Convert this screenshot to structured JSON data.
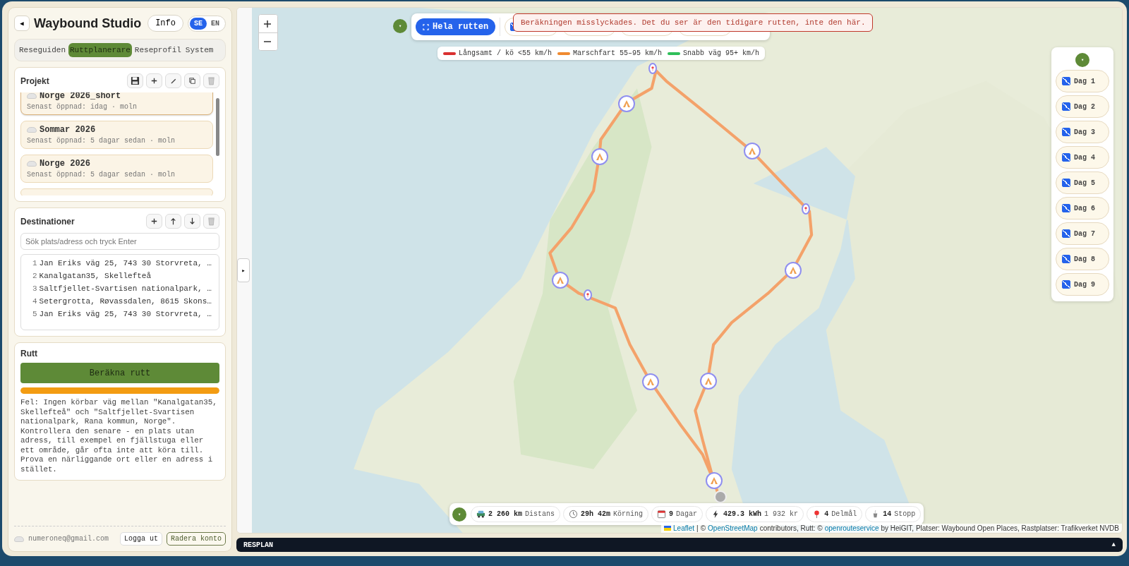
{
  "sidebar": {
    "collapse_button": "◀",
    "title": "Waybound Studio",
    "info_button": "Info",
    "languages": [
      {
        "label": "SE",
        "selected": true
      },
      {
        "label": "EN",
        "selected": false
      }
    ],
    "tabs": [
      {
        "label": "Reseguiden",
        "selected": false
      },
      {
        "label": "Ruttplanerare",
        "selected": true
      },
      {
        "label": "Reseprofil",
        "selected": false
      },
      {
        "label": "System",
        "selected": false
      }
    ],
    "projects": {
      "title": "Projekt",
      "items": [
        {
          "name": "Norge 2026_short",
          "subtitle": "Senast öppnad: idag · moln",
          "selected": true
        },
        {
          "name": "Sommar 2026",
          "subtitle": "Senast öppnad: 5 dagar sedan · moln",
          "selected": false
        },
        {
          "name": "Norge 2026",
          "subtitle": "Senast öppnad: 5 dagar sedan · moln",
          "selected": false
        }
      ]
    },
    "destinations": {
      "title": "Destinationer",
      "search": {
        "placeholder": "Sök plats/adress och tryck Enter"
      },
      "items": [
        {
          "number": "1",
          "text": "Jan Eriks väg 25, 743 30 Storvreta, …"
        },
        {
          "number": "2",
          "text": "Kanalgatan35, Skellefteå"
        },
        {
          "number": "3",
          "text": "Saltfjellet-Svartisen nationalpark, …"
        },
        {
          "number": "4",
          "text": "Setergrotta, Røvassdalen, 8615 Skons…"
        },
        {
          "number": "5",
          "text": "Jan Eriks väg 25, 743 30 Storvreta, …"
        }
      ]
    },
    "route": {
      "title": "Rutt",
      "button": "Beräkna rutt",
      "progress": {
        "level": 1
      },
      "error": "Fel: Ingen körbar väg mellan \"Kanalgatan35, Skellefteå\" och \"Saltfjellet-Svartisen nationalpark, Rana kommun, Norge\". Kontrollera den senare - en plats utan adress, till exempel en fjällstuga eller ett område, går ofta inte att köra till. Prova en närliggande ort eller en adress i stället."
    },
    "account": {
      "email": "numeroneq@gmail.com",
      "buttons": [
        "Logga ut",
        "Radera konto"
      ]
    }
  },
  "map": {
    "sidebar_toggle": "▸",
    "toolbar_toggle": "▾",
    "fit_button": "Hela rutten",
    "layer_checked": true,
    "error_toast": "Beräkningen misslyckades. Det du ser är den tidigare rutten, inte den här.",
    "legend": [
      {
        "label": "Långsamt / kö <55 km/h",
        "color": "#d93030"
      },
      {
        "label": "Marschfart 55–95 km/h",
        "color": "#f08a30"
      },
      {
        "label": "Snabb väg 95+ km/h",
        "color": "#2fbf5a"
      }
    ],
    "days_toggle": "▾",
    "days": [
      {
        "label": "Dag 1",
        "checked": true
      },
      {
        "label": "Dag 2",
        "checked": true
      },
      {
        "label": "Dag 3",
        "checked": true
      },
      {
        "label": "Dag 4",
        "checked": true
      },
      {
        "label": "Dag 5",
        "checked": true
      },
      {
        "label": "Dag 6",
        "checked": true
      },
      {
        "label": "Dag 7",
        "checked": true
      },
      {
        "label": "Dag 8",
        "checked": true
      },
      {
        "label": "Dag 9",
        "checked": true
      }
    ],
    "stats_toggle": "▾",
    "stats": [
      {
        "kind": "car",
        "value": "2 260 km",
        "label": "Distans"
      },
      {
        "kind": "clock",
        "value": "29h 42m",
        "label": "Körning"
      },
      {
        "kind": "calendar",
        "value": "9",
        "label": "Dagar"
      },
      {
        "kind": "bolt",
        "value": "429.3 kWh",
        "label": "1 932 kr"
      },
      {
        "kind": "pin",
        "value": "4",
        "label": "Delmål"
      },
      {
        "kind": "cup",
        "value": "14",
        "label": "Stopp"
      }
    ],
    "attribution": [
      {
        "text": "Leaflet",
        "kind": "link"
      },
      {
        "text": "|",
        "kind": "text"
      },
      {
        "text": "©",
        "kind": "text"
      },
      {
        "text": "OpenStreetMap",
        "kind": "link"
      },
      {
        "text": "contributors, Rutt: ©",
        "kind": "text"
      },
      {
        "text": "openrouteservice",
        "kind": "link"
      },
      {
        "text": "by HeiGIT, Platser: Waybound Open Places, Rastplatser: Trafikverket NVDB",
        "kind": "text"
      }
    ]
  },
  "plan_bar": {
    "title": "RESPLAN",
    "toggle": "▲"
  }
}
